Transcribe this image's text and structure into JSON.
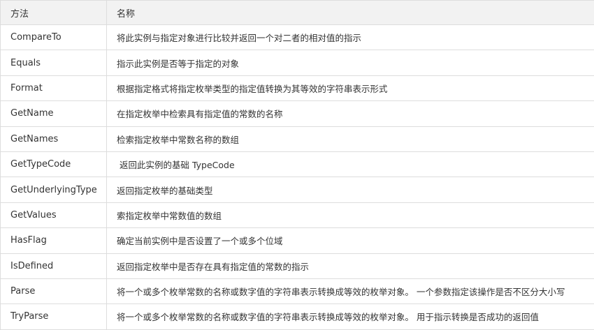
{
  "table": {
    "headers": [
      "方法",
      "名称"
    ],
    "rows": [
      {
        "method": "CompareTo",
        "desc": "将此实例与指定对象进行比较并返回一个对二者的相对值的指示"
      },
      {
        "method": "Equals",
        "desc": "指示此实例是否等于指定的对象"
      },
      {
        "method": "Format",
        "desc": "根据指定格式将指定枚举类型的指定值转换为其等效的字符串表示形式"
      },
      {
        "method": "GetName",
        "desc": "在指定枚举中检索具有指定值的常数的名称"
      },
      {
        "method": "GetNames",
        "desc": "检索指定枚举中常数名称的数组"
      },
      {
        "method": "GetTypeCode",
        "desc": " 返回此实例的基础 TypeCode"
      },
      {
        "method": "GetUnderlyingType",
        "desc": "返回指定枚举的基础类型"
      },
      {
        "method": "GetValues",
        "desc": "索指定枚举中常数值的数组"
      },
      {
        "method": "HasFlag",
        "desc": "确定当前实例中是否设置了一个或多个位域"
      },
      {
        "method": "IsDefined",
        "desc": "返回指定枚举中是否存在具有指定值的常数的指示"
      },
      {
        "method": "Parse",
        "desc": "将一个或多个枚举常数的名称或数字值的字符串表示转换成等效的枚举对象。 一个参数指定该操作是否不区分大小写"
      },
      {
        "method": "TryParse",
        "desc": "将一个或多个枚举常数的名称或数字值的字符串表示转换成等效的枚举对象。 用于指示转换是否成功的返回值"
      }
    ]
  }
}
